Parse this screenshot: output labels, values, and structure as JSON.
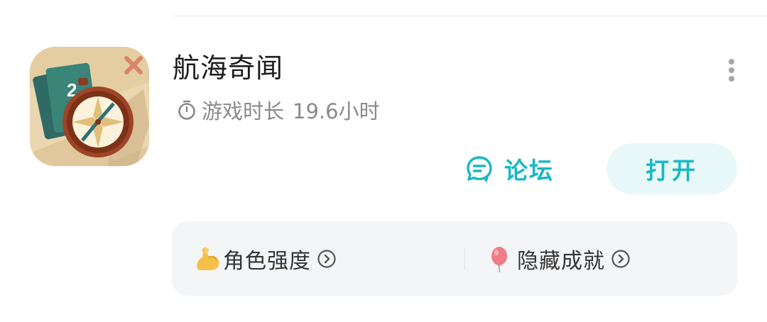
{
  "game": {
    "title": "航海奇闻",
    "icon_name": "compass-cards-game-icon",
    "playtime_label": "游戏时长",
    "playtime_value": "19.6小时"
  },
  "actions": {
    "forum_label": "论坛",
    "open_label": "打开"
  },
  "features": [
    {
      "label": "角色强度",
      "icon": "flexed-biceps-emoji"
    },
    {
      "label": "隐藏成就",
      "icon": "balloon-emoji"
    }
  ],
  "colors": {
    "accent": "#19b8c4",
    "open_button_bg": "#e8f7f8",
    "panel_bg": "#f4f5f7",
    "title": "#1c1c1c",
    "secondary_text": "#8a8a8a"
  }
}
